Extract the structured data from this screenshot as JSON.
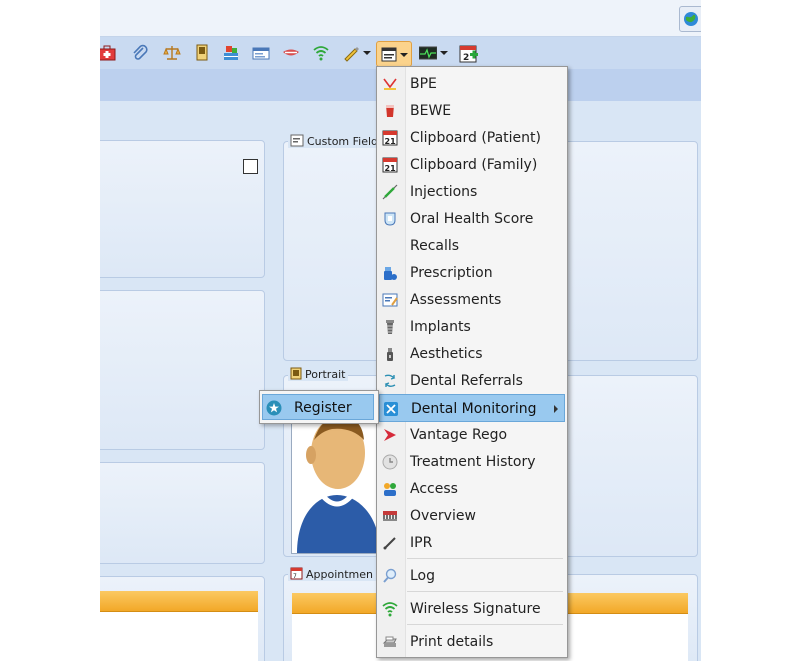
{
  "panels": {
    "custom_fields_title": "Custom Field",
    "portrait_title": "Portrait",
    "appointments_title": "Appointmen"
  },
  "menu": {
    "items": [
      {
        "label": "BPE",
        "icon": "bpe-icon"
      },
      {
        "label": "BEWE",
        "icon": "bewe-icon"
      },
      {
        "label": "Clipboard (Patient)",
        "icon": "calendar-21-icon"
      },
      {
        "label": "Clipboard (Family)",
        "icon": "calendar-21-icon"
      },
      {
        "label": "Injections",
        "icon": "syringe-icon"
      },
      {
        "label": "Oral Health Score",
        "icon": "tooth-score-icon"
      },
      {
        "label": "Recalls",
        "icon": ""
      },
      {
        "label": "Prescription",
        "icon": "pill-bottle-icon"
      },
      {
        "label": "Assessments",
        "icon": "assessment-icon"
      },
      {
        "label": "Implants",
        "icon": "implant-icon"
      },
      {
        "label": "Aesthetics",
        "icon": "aesthetics-icon"
      },
      {
        "label": "Dental Referrals",
        "icon": "referral-icon"
      },
      {
        "label": "Dental Monitoring",
        "icon": "dental-monitoring-icon",
        "has_submenu": true,
        "highlighted": true
      },
      {
        "label": "Vantage Rego",
        "icon": "vantage-icon"
      },
      {
        "label": "Treatment History",
        "icon": "history-icon"
      },
      {
        "label": "Access",
        "icon": "access-icon"
      },
      {
        "label": "Overview",
        "icon": "overview-icon"
      },
      {
        "label": "IPR",
        "icon": "ipr-icon"
      },
      {
        "label": "Log",
        "icon": "log-search-icon"
      },
      {
        "label": "Wireless Signature",
        "icon": "wireless-signal-icon"
      },
      {
        "label": "Print details",
        "icon": "printer-icon"
      }
    ]
  },
  "submenu": {
    "items": [
      {
        "label": "Register",
        "icon": "register-star-icon"
      }
    ]
  },
  "colors": {
    "accent_highlight": "#99c9ef",
    "toolbar_active": "#fbd38c",
    "grid_header": "#f2a828"
  }
}
